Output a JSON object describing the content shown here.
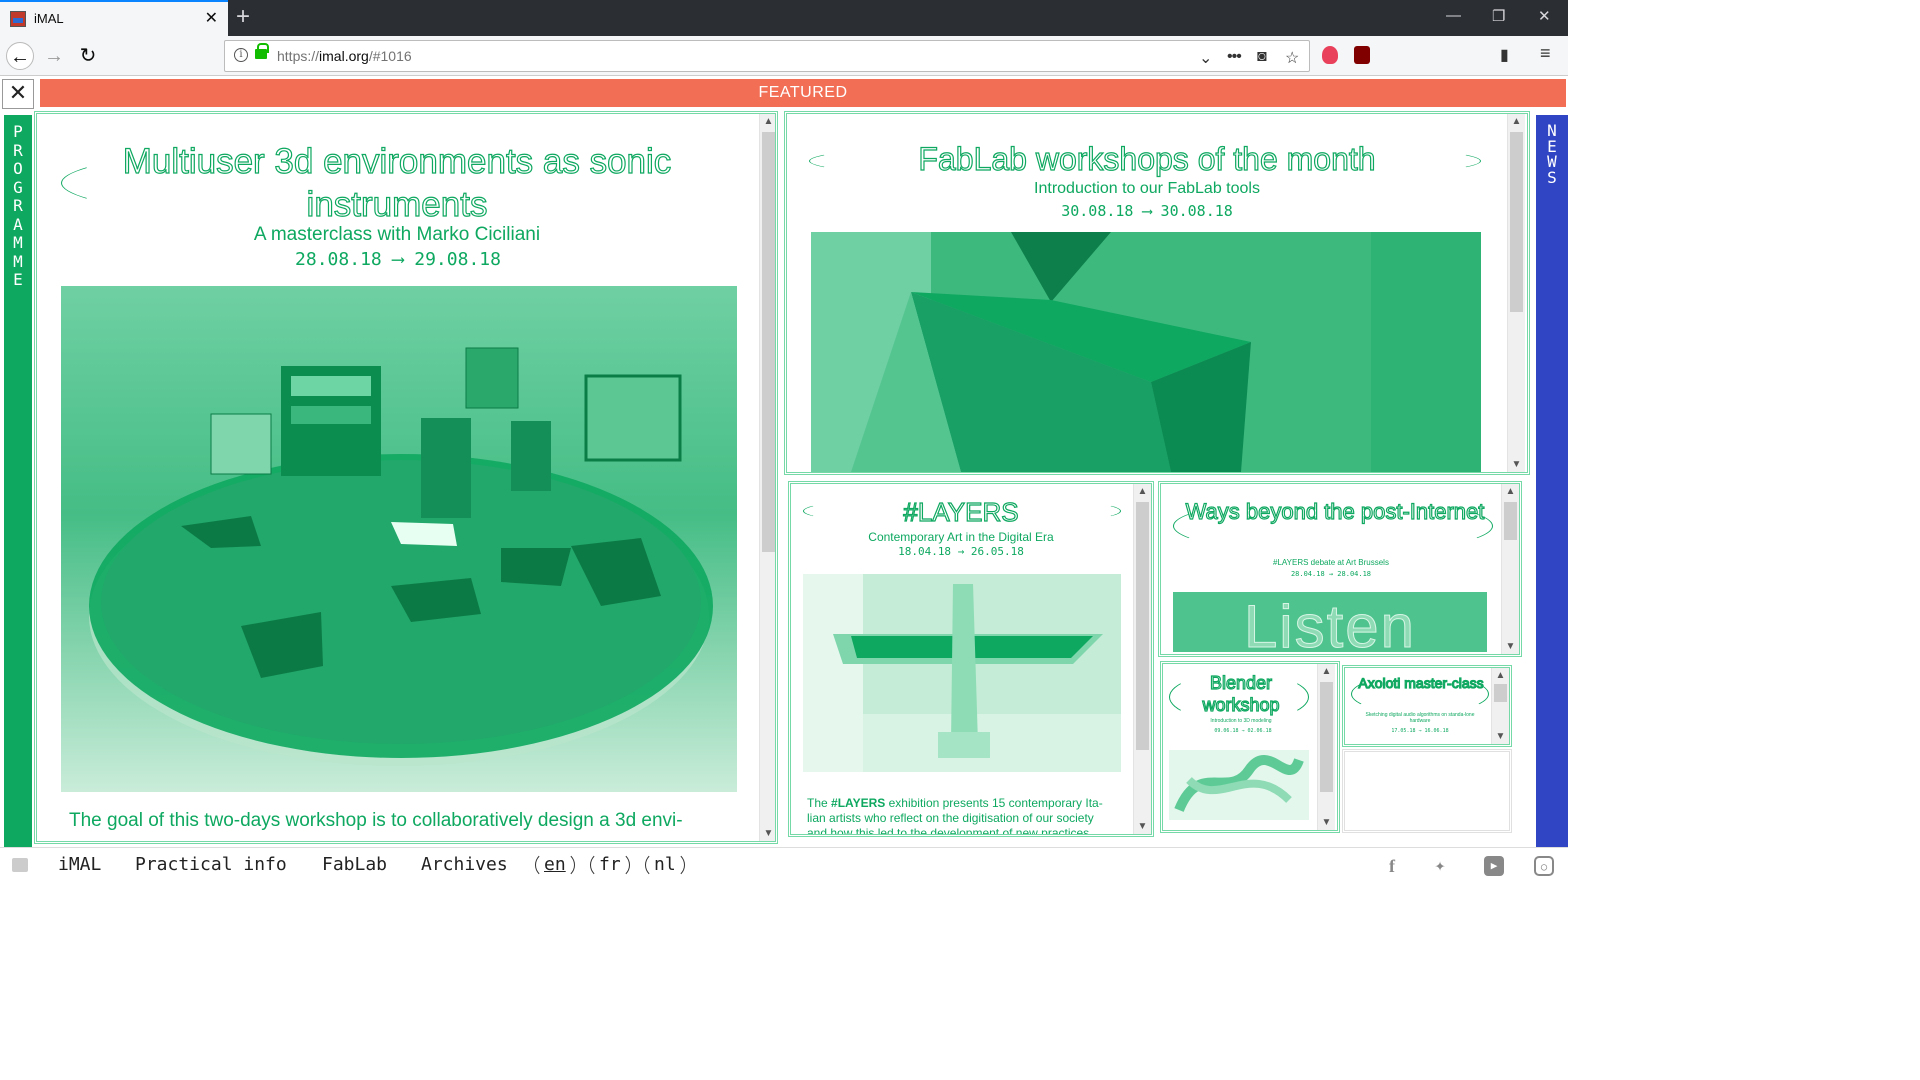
{
  "browser": {
    "tab_title": "iMAL",
    "url_prefix": "https://",
    "url_host": "imal.org",
    "url_path": "/#1016"
  },
  "page": {
    "featured_label": "FEATURED",
    "left_sidebar": "PROGRAMME",
    "right_sidebar": "NEWS"
  },
  "main_event": {
    "title": "Multiuser 3d environments as sonic instruments",
    "subtitle": "A masterclass with Marko Ciciliani",
    "dates": "28.08.18 ⟶ 29.08.18",
    "body": "The goal of this two-days workshop is to collaboratively design a 3d envi-"
  },
  "fablab_event": {
    "title": "FabLab workshops of the month",
    "subtitle": "Introduction to our FabLab tools",
    "dates": "30.08.18 ⟶ 30.08.18"
  },
  "layers_event": {
    "title": "#LAYERS",
    "subtitle": "Contemporary Art in the Digital Era",
    "dates": "18.04.18 → 26.05.18",
    "body_prefix": "The ",
    "body_bold": "#LAYERS",
    "body_rest": " exhibition presents 15 contemporary Ita-lian artists who reflect on the digitisation of our society and how this led to the development of new practices,"
  },
  "ways_event": {
    "title": "Ways beyond the post-Internet",
    "subtitle": "#LAYERS debate at Art Brussels",
    "dates": "28.04.18 → 28.04.18",
    "image_text": "Listen"
  },
  "blender_event": {
    "title": "Blender workshop",
    "subtitle": "Introduction to 3D modeling",
    "dates": "09.06.18 → 02.06.18"
  },
  "axoloti_event": {
    "title": "Axoloti master-class",
    "subtitle": "Sketching digital audio algorithms on standa-lone hardware",
    "dates": "17.05.18 → 16.06.18"
  },
  "footer": {
    "nav": [
      "iMAL",
      "Practical info",
      "FabLab",
      "Archives"
    ],
    "langs": [
      "en",
      "fr",
      "nl"
    ],
    "active_lang": "en"
  },
  "colors": {
    "green": "#0ea860",
    "featured_bar": "#f26f55",
    "news_bar": "#3045c4"
  }
}
